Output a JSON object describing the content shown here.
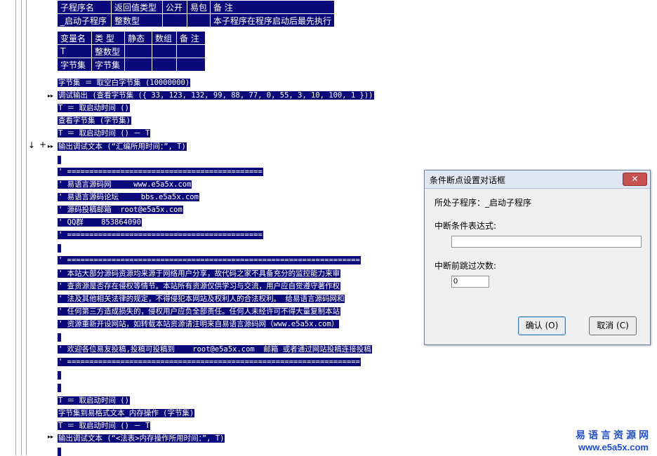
{
  "subprogram_table": {
    "headers": [
      "子程序名",
      "返回值类型",
      "公开",
      "易包",
      "备 注"
    ],
    "row": [
      "_启动子程序",
      "整数型",
      "",
      "",
      "本子程序在程序启动后最先执行"
    ]
  },
  "variable_table": {
    "headers": [
      "变量名",
      "类 型",
      "静态",
      "数组",
      "备 注"
    ],
    "rows": [
      [
        "T",
        "整数型",
        "",
        "",
        ""
      ],
      [
        "字节集",
        "字节集",
        "",
        "",
        ""
      ]
    ]
  },
  "code_lines": [
    "字节集 ＝ 取空白字节集 (10000000)",
    "调试输出 (查看字节集 ({ 33, 123, 132, 99, 88, 77, 0, 55, 3, 10, 100, 1 }))",
    "T ＝ 取启动时间 ()",
    "查看字节集 (字节集)",
    "T ＝ 取启动时间 () － T",
    "输出调试文本 (“汇编所用时间：”, T)",
    "",
    "' ============================================",
    "' 易语言源码网     www.e5a5x.com",
    "' 易语言源码论坛     bbs.e5a5x.com",
    "' 源码投稿邮箱  root@e5a5x.com",
    "' QQ群    853864090",
    "' ============================================",
    "",
    "' ==================================================================",
    "' 本站大部分源码资源均来源于网络用户分享，故代码之家不具备充分的监控能力来审",
    "' 查资源是否存在侵权等情节。本站所有资源仅供学习与交流，用户应自觉遵守著作权",
    "' 法及其他相关法律的规定，不得侵犯本网站及权利人的合法权利。 给易语言源码网和",
    "' 任何第三方造成损失的，侵权用户应负全部责任。任何人未经许可不得大量复制本站",
    "' 资源重新开设网站，如转载本站资源请注明来自易语言源码网（www.e5a5x.com）",
    "",
    "' 欢迎各位易友投稿,投稿可投稿到    root@e5a5x.com  邮箱 或者通过网站投稿连接投稿",
    "' ==================================================================",
    "",
    "",
    "T ＝ 取启动时间 ()",
    "字节集到易格式文本_内存操作 (字节集)",
    "T ＝ 取启动时间 () － T",
    "输出调试文本 (“<法表>内存操作所用时间：”, T)",
    ""
  ],
  "gutter_markers": {
    "expand": "▸▸",
    "step_arrow": "↓",
    "plus": "+"
  },
  "dialog": {
    "title": "条件断点设置对话框",
    "close_label": "✕",
    "subprogram_label": "所处子程序：_启动子程序",
    "condition_label": "中断条件表达式:",
    "condition_value": "",
    "skip_label": "中断前跳过次数:",
    "skip_value": "0",
    "ok_label": "确认 (O)",
    "cancel_label": "取消 (C)"
  },
  "watermark": {
    "line1": "易语言资源网",
    "line2": "www.e5a5x.com"
  }
}
